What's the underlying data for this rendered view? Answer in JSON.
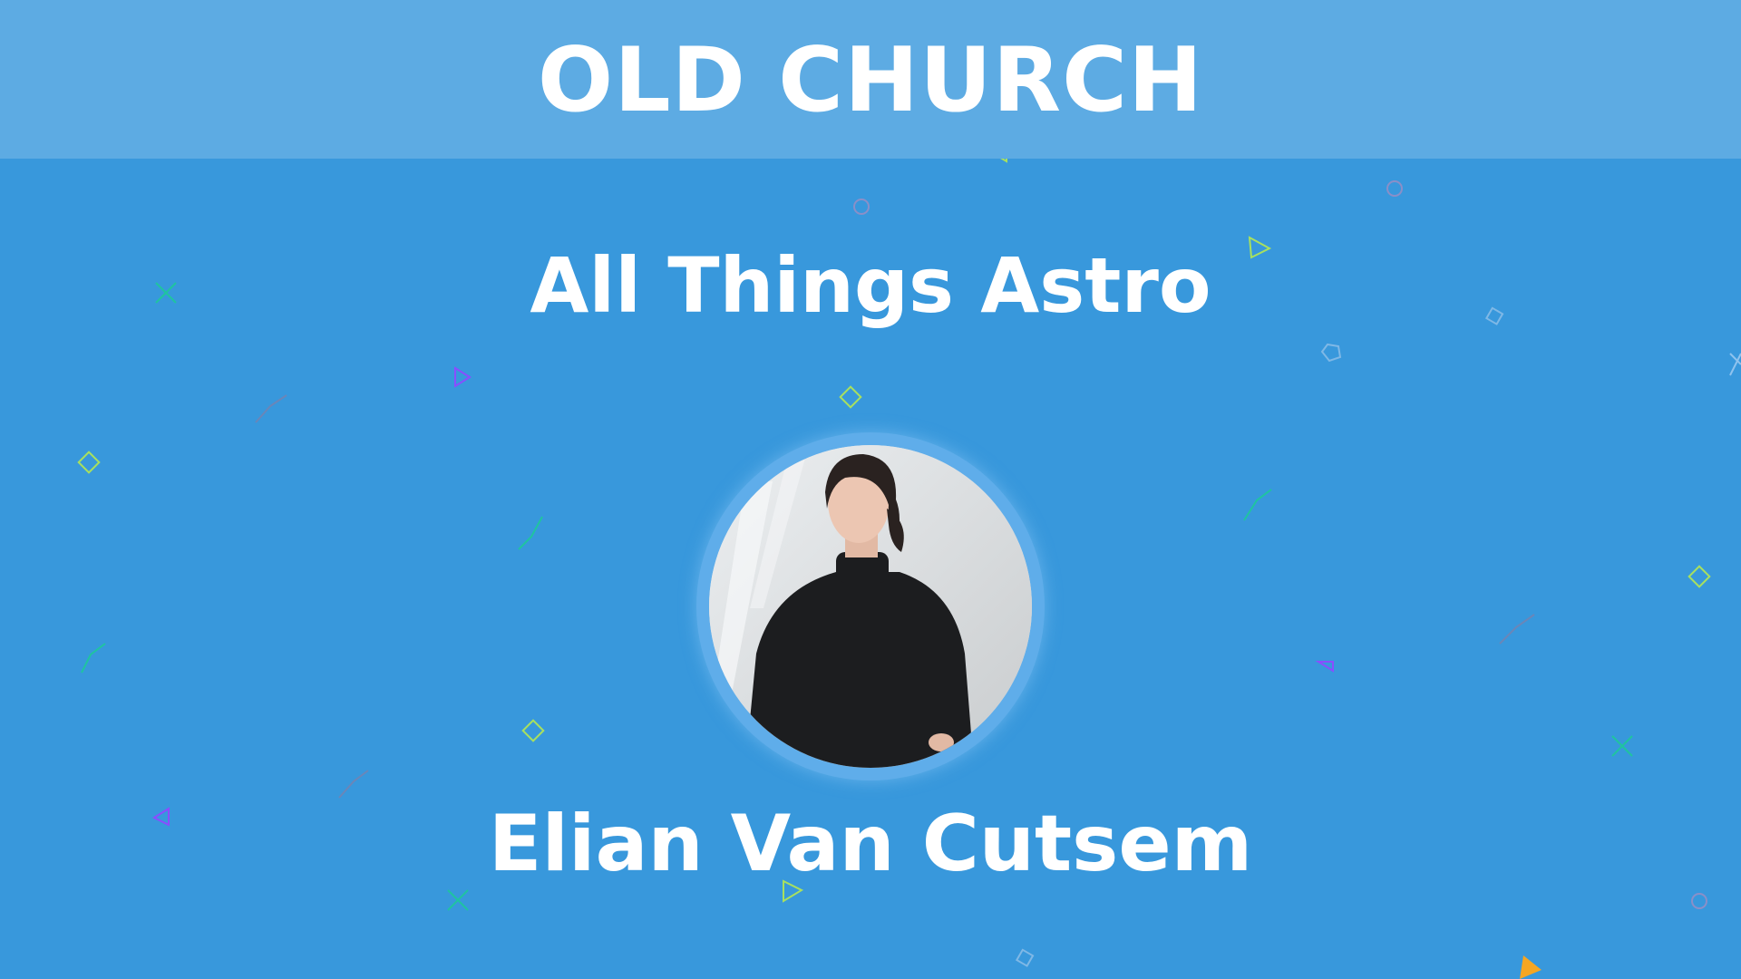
{
  "banner": {
    "title": "OLD CHURCH"
  },
  "talk": {
    "title": "All Things Astro"
  },
  "speaker": {
    "name": "Elian Van Cutsem",
    "photo_icon": "speaker-photo"
  },
  "colors": {
    "background": "#3898dc",
    "banner": "#5dabe3",
    "text": "#ffffff",
    "confetti_orange": "#f5a623",
    "confetti_green": "#a8e05f",
    "confetti_purple": "#8a4dff",
    "confetti_teal": "#1fc4a0"
  }
}
